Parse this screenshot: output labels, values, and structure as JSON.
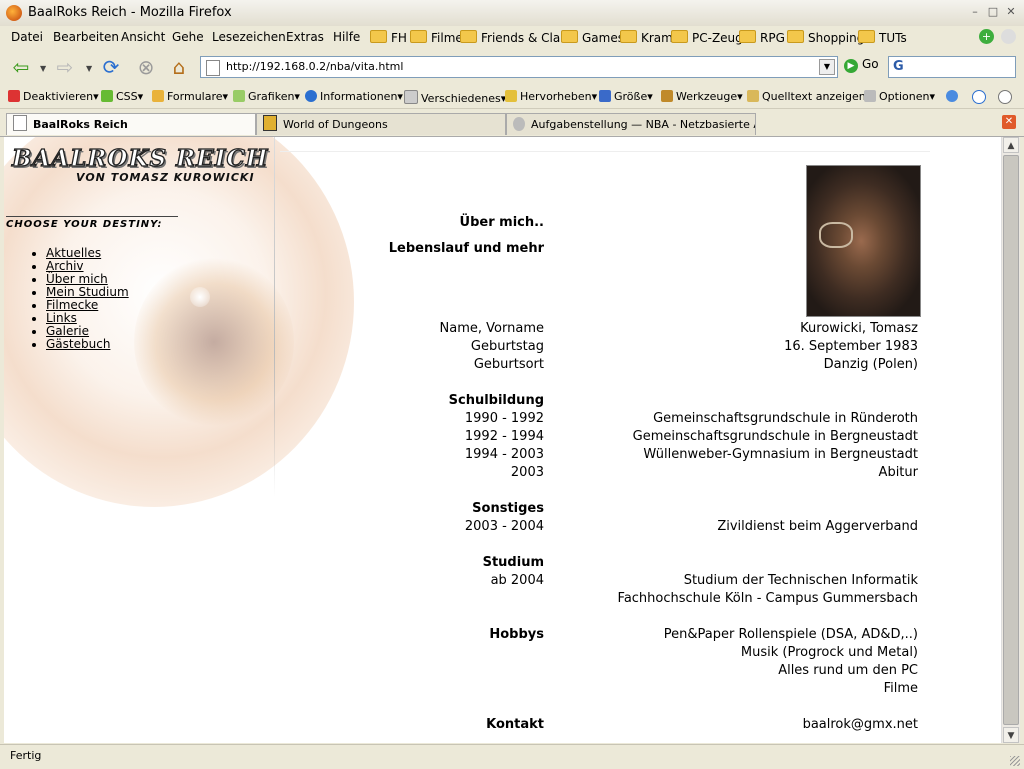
{
  "window": {
    "title": "BaalRoks Reich - Mozilla Firefox"
  },
  "menubar": {
    "items": [
      "Datei",
      "Bearbeiten",
      "Ansicht",
      "Gehe",
      "Lesezeichen",
      "Extras",
      "Hilfe"
    ],
    "bookmarks": [
      "FH",
      "Filme",
      "Friends & Clans",
      "Games",
      "Kram",
      "PC-Zeug",
      "RPG",
      "Shopping",
      "TUTs"
    ]
  },
  "navbar": {
    "url": "http://192.168.0.2/nba/vita.html",
    "go_label": "Go"
  },
  "devbar": {
    "items": [
      "Deaktivieren▾",
      "CSS▾",
      "Formulare▾",
      "Grafiken▾",
      "Informationen▾",
      "Verschiedenes▾",
      "Hervorheben▾",
      "Größe▾",
      "Werkzeuge▾",
      "Quelltext anzeigen",
      "Optionen▾"
    ]
  },
  "tabs": [
    {
      "label": "BaalRoks Reich"
    },
    {
      "label": "World of Dungeons"
    },
    {
      "label": "Aufgabenstellung — NBA - Netzbasierte An..."
    }
  ],
  "site": {
    "logo_title": "BAALROKS REICH",
    "logo_sub": "VON TOMASZ KUROWICKI",
    "destiny": "CHOOSE YOUR DESTINY:",
    "nav": [
      "Aktuelles",
      "Archiv",
      "Über mich",
      "Mein Studium",
      "Filmecke",
      "Links",
      "Galerie",
      "Gästebuch"
    ]
  },
  "vita": {
    "heading1": "Über mich..",
    "heading2": "Lebenslauf und mehr",
    "personal": [
      {
        "label": "Name, Vorname",
        "value": "Kurowicki, Tomasz"
      },
      {
        "label": "Geburtstag",
        "value": "16. September 1983"
      },
      {
        "label": "Geburtsort",
        "value": "Danzig (Polen)"
      }
    ],
    "schul_title": "Schulbildung",
    "schul": [
      {
        "label": "1990 - 1992",
        "value": "Gemeinschaftsgrundschule in Ründeroth"
      },
      {
        "label": "1992 - 1994",
        "value": "Gemeinschaftsgrundschule in Bergneustadt"
      },
      {
        "label": "1994 - 2003",
        "value": "Wüllenweber-Gymnasium in Bergneustadt"
      },
      {
        "label": "2003",
        "value": "Abitur"
      }
    ],
    "sonst_title": "Sonstiges",
    "sonst": [
      {
        "label": "2003 - 2004",
        "value": "Zivildienst beim Aggerverband"
      }
    ],
    "studium_title": "Studium",
    "studium": {
      "label": "ab 2004",
      "lines": [
        "Studium der Technischen Informatik",
        "Fachhochschule Köln - Campus Gummersbach"
      ]
    },
    "hobbys_title": "Hobbys",
    "hobbys": [
      "Pen&Paper Rollenspiele (DSA, AD&D,..)",
      "Musik (Progrock und Metal)",
      "Alles rund um den PC",
      "Filme"
    ],
    "kontakt_title": "Kontakt",
    "kontakt": "baalrok@gmx.net"
  },
  "status": {
    "text": "Fertig"
  }
}
